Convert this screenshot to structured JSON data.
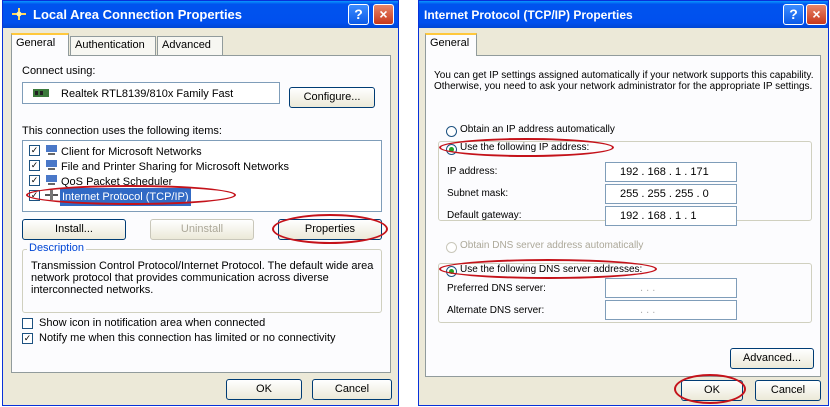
{
  "lan_dialog": {
    "title": "Local Area Connection Properties",
    "help_glyph": "?",
    "close_glyph": "×",
    "tabs": [
      "General",
      "Authentication",
      "Advanced"
    ],
    "connect_using_label": "Connect using:",
    "adapter_name": "Realtek RTL8139/810x Family Fast",
    "configure_label": "Configure...",
    "items_label": "This connection uses the following items:",
    "items": [
      {
        "label": "Client for Microsoft Networks",
        "checked": true
      },
      {
        "label": "File and Printer Sharing for Microsoft Networks",
        "checked": true
      },
      {
        "label": "QoS Packet Scheduler",
        "checked": true
      },
      {
        "label": "Internet Protocol (TCP/IP)",
        "checked": true,
        "selected": true
      }
    ],
    "install_label": "Install...",
    "uninstall_label": "Uninstall",
    "properties_label": "Properties",
    "description_title": "Description",
    "description_text": "Transmission Control Protocol/Internet Protocol. The default wide area network protocol that provides communication across diverse interconnected networks.",
    "show_icon_label": "Show icon in notification area when connected",
    "notify_label": "Notify me when this connection has limited or no connectivity",
    "ok_label": "OK",
    "cancel_label": "Cancel"
  },
  "tcpip_dialog": {
    "title": "Internet Protocol (TCP/IP) Properties",
    "help_glyph": "?",
    "close_glyph": "×",
    "tab": "General",
    "intro_text": "You can get IP settings assigned automatically if your network supports this capability. Otherwise, you need to ask your network administrator for the appropriate IP settings.",
    "obtain_ip_label": "Obtain an IP address automatically",
    "use_ip_label": "Use the following IP address:",
    "ip_address_label": "IP address:",
    "ip_address_value": "192 . 168 . 1 . 171",
    "subnet_label": "Subnet mask:",
    "subnet_value": "255 . 255 . 255 . 0",
    "gateway_label": "Default gateway:",
    "gateway_value": "192 . 168 . 1 . 1",
    "obtain_dns_label": "Obtain DNS server address automatically",
    "use_dns_label": "Use the following DNS server addresses:",
    "preferred_dns_label": "Preferred DNS server:",
    "alternate_dns_label": "Alternate DNS server:",
    "dns_empty_value": ".     .     .",
    "advanced_label": "Advanced...",
    "ok_label": "OK",
    "cancel_label": "Cancel"
  },
  "colors": {
    "title_bar": "#0054e3",
    "dialog_bg": "#ece9d8",
    "highlight_oval": "#c4121a",
    "selection": "#316ac5"
  }
}
